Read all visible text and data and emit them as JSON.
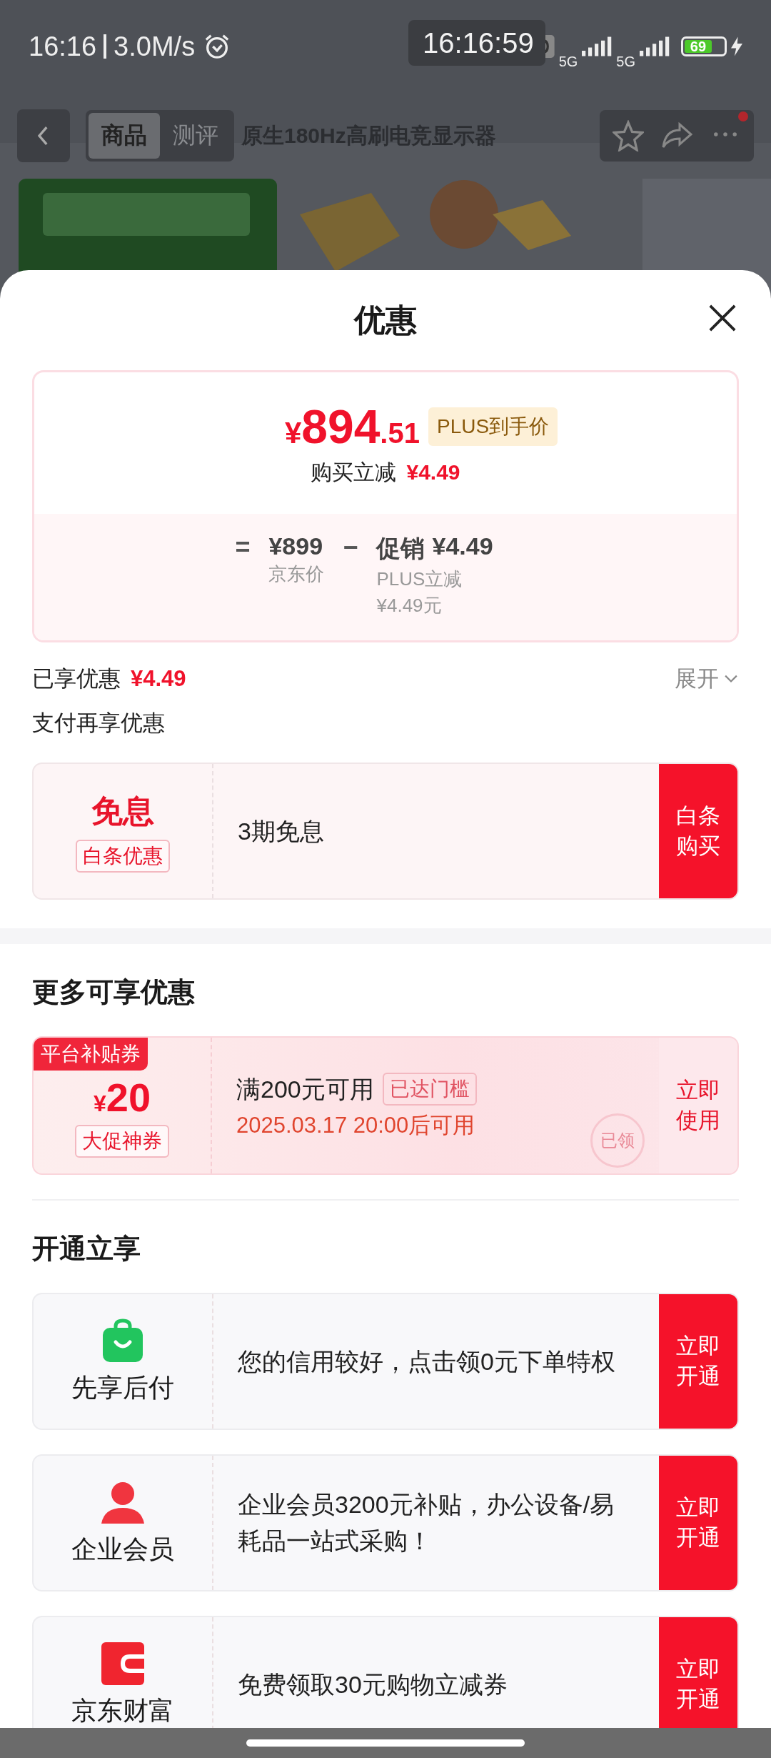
{
  "status_bar": {
    "time": "16:16",
    "speed": "3.0M/s",
    "clock_overlay": "16:16:59",
    "network_1": "5G",
    "network_2": "5G",
    "battery": "69"
  },
  "nav": {
    "tabs": [
      {
        "label": "商品",
        "selected": true
      },
      {
        "label": "测评",
        "selected": false
      }
    ],
    "title": "原生180Hz高刷电竞显示器",
    "has_notification": true
  },
  "sheet": {
    "title": "优惠"
  },
  "price": {
    "currency": "¥",
    "integer": "894",
    "decimal": ".51",
    "tag": "PLUS到手价",
    "reduction_label": "购买立减",
    "reduction_value": "¥4.49",
    "breakdown": {
      "equals": "=",
      "jd_price": "¥899",
      "jd_price_label": "京东价",
      "minus": "−",
      "promo_label": "促销",
      "promo_value": "¥4.49",
      "promo_detail_1": "PLUS立减",
      "promo_detail_2": "¥4.49元"
    }
  },
  "enjoyed": {
    "label": "已享优惠",
    "value": "¥4.49",
    "expand": "展开"
  },
  "pay_section": {
    "title": "支付再享优惠",
    "offers": [
      {
        "headline": "免息",
        "tag": "白条优惠",
        "text": "3期免息",
        "action": "白条购买"
      }
    ]
  },
  "more_section": {
    "title": "更多可享优惠",
    "coupons": [
      {
        "corner": "平台补贴券",
        "currency": "¥",
        "amount": "20",
        "tag": "大促神券",
        "condition": "满200元可用",
        "status": "已达门槛",
        "time": "2025.03.17 20:00后可用",
        "action": "立即使用",
        "stamp": "已领"
      }
    ]
  },
  "open_section": {
    "title": "开通立享",
    "services": [
      {
        "kind": "bag",
        "name": "先享后付",
        "text": "您的信用较好，点击领0元下单特权",
        "action": "立即开通"
      },
      {
        "kind": "person",
        "name": "企业会员",
        "text": "企业会员3200元补贴，办公设备/易耗品一站式采购！",
        "action": "立即开通"
      },
      {
        "kind": "wallet",
        "name": "京东财富",
        "text": "免费领取30元购物立减券",
        "action": "立即开通"
      }
    ]
  }
}
